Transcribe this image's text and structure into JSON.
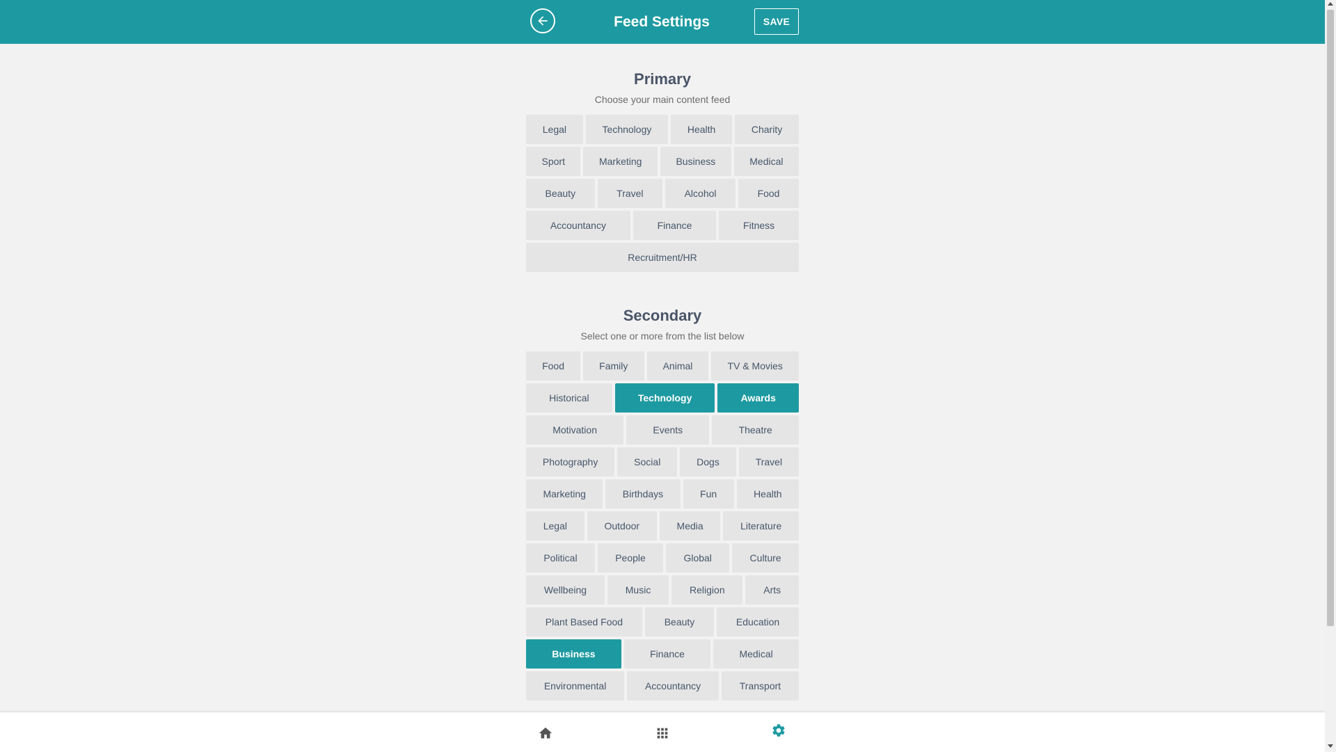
{
  "header": {
    "title": "Feed Settings",
    "save_label": "SAVE",
    "back_icon": "arrow-left-icon",
    "color": "#1d9aa1"
  },
  "primary": {
    "title": "Primary",
    "subtitle": "Choose your main content feed",
    "rows": [
      [
        "Legal",
        "Technology",
        "Health",
        "Charity"
      ],
      [
        "Sport",
        "Marketing",
        "Business",
        "Medical"
      ],
      [
        "Beauty",
        "Travel",
        "Alcohol",
        "Food"
      ],
      [
        "Accountancy",
        "Finance",
        "Fitness"
      ],
      [
        "Recruitment/HR"
      ]
    ]
  },
  "secondary": {
    "title": "Secondary",
    "subtitle": "Select one or more from the list below",
    "rows": [
      [
        "Food",
        "Family",
        "Animal",
        "TV & Movies"
      ],
      [
        "Historical",
        "Technology",
        "Awards"
      ],
      [
        "Motivation",
        "Events",
        "Theatre"
      ],
      [
        "Photography",
        "Social",
        "Dogs",
        "Travel"
      ],
      [
        "Marketing",
        "Birthdays",
        "Fun",
        "Health"
      ],
      [
        "Legal",
        "Outdoor",
        "Media",
        "Literature"
      ],
      [
        "Political",
        "People",
        "Global",
        "Culture"
      ],
      [
        "Wellbeing",
        "Music",
        "Religion",
        "Arts"
      ],
      [
        "Plant Based Food",
        "Beauty",
        "Education"
      ],
      [
        "Business",
        "Finance",
        "Medical"
      ],
      [
        "Environmental",
        "Accountancy",
        "Transport"
      ]
    ],
    "selected": [
      "Technology",
      "Awards",
      "Business"
    ]
  },
  "bottom_nav": {
    "items": [
      {
        "icon": "home-icon",
        "active": false
      },
      {
        "icon": "apps-grid-icon",
        "active": false
      },
      {
        "icon": "settings-gear-icon",
        "active": true
      }
    ],
    "active_color": "#1d9aa1",
    "inactive_color": "#555555"
  }
}
